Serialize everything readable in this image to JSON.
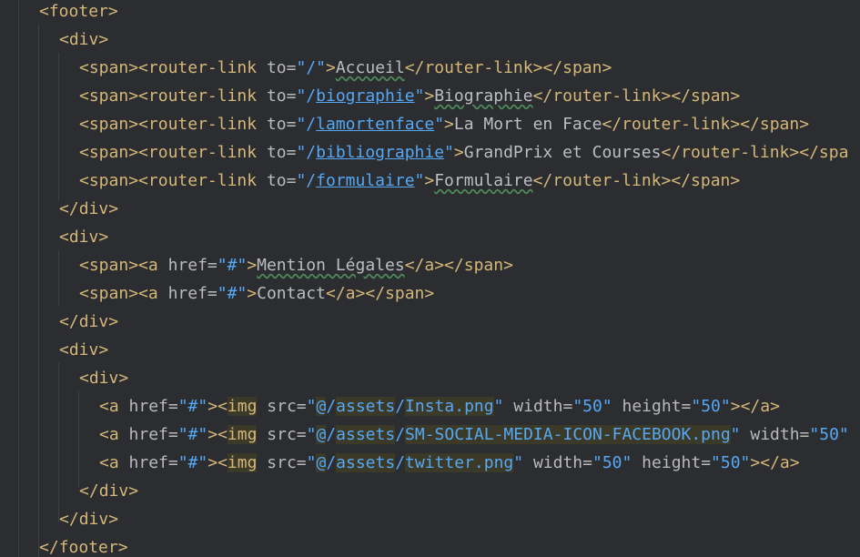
{
  "editor": {
    "lines": [
      {
        "indent": 1,
        "tokens": [
          {
            "t": "<",
            "c": "tk-bracket"
          },
          {
            "t": "footer",
            "c": "tk-tag"
          },
          {
            "t": ">",
            "c": "tk-bracket"
          }
        ]
      },
      {
        "indent": 2,
        "tokens": [
          {
            "t": "<",
            "c": "tk-bracket"
          },
          {
            "t": "div",
            "c": "tk-tag"
          },
          {
            "t": ">",
            "c": "tk-bracket"
          }
        ]
      },
      {
        "indent": 3,
        "tokens": [
          {
            "t": "<",
            "c": "tk-bracket"
          },
          {
            "t": "span",
            "c": "tk-tag"
          },
          {
            "t": "><",
            "c": "tk-bracket"
          },
          {
            "t": "router-link",
            "c": "tk-tag"
          },
          {
            "t": " to",
            "c": "tk-attr"
          },
          {
            "t": "=",
            "c": "tk-eq"
          },
          {
            "t": "\"",
            "c": "tk-strval"
          },
          {
            "t": "/",
            "c": "tk-strval"
          },
          {
            "t": "\"",
            "c": "tk-strval"
          },
          {
            "t": ">",
            "c": "tk-bracket"
          },
          {
            "t": "Accueil",
            "c": "tk-text tk-typo"
          },
          {
            "t": "</",
            "c": "tk-bracket"
          },
          {
            "t": "router-link",
            "c": "tk-tag"
          },
          {
            "t": "></",
            "c": "tk-bracket"
          },
          {
            "t": "span",
            "c": "tk-tag"
          },
          {
            "t": ">",
            "c": "tk-bracket"
          }
        ]
      },
      {
        "indent": 3,
        "tokens": [
          {
            "t": "<",
            "c": "tk-bracket"
          },
          {
            "t": "span",
            "c": "tk-tag"
          },
          {
            "t": "><",
            "c": "tk-bracket"
          },
          {
            "t": "router-link",
            "c": "tk-tag"
          },
          {
            "t": " to",
            "c": "tk-attr"
          },
          {
            "t": "=",
            "c": "tk-eq"
          },
          {
            "t": "\"/",
            "c": "tk-strval"
          },
          {
            "t": "biographie",
            "c": "tk-strval tk-link"
          },
          {
            "t": "\"",
            "c": "tk-strval"
          },
          {
            "t": ">",
            "c": "tk-bracket"
          },
          {
            "t": "Biographie",
            "c": "tk-text tk-typo"
          },
          {
            "t": "</",
            "c": "tk-bracket"
          },
          {
            "t": "router-link",
            "c": "tk-tag"
          },
          {
            "t": "></",
            "c": "tk-bracket"
          },
          {
            "t": "span",
            "c": "tk-tag"
          },
          {
            "t": ">",
            "c": "tk-bracket"
          }
        ]
      },
      {
        "indent": 3,
        "tokens": [
          {
            "t": "<",
            "c": "tk-bracket"
          },
          {
            "t": "span",
            "c": "tk-tag"
          },
          {
            "t": "><",
            "c": "tk-bracket"
          },
          {
            "t": "router-link",
            "c": "tk-tag"
          },
          {
            "t": " to",
            "c": "tk-attr"
          },
          {
            "t": "=",
            "c": "tk-eq"
          },
          {
            "t": "\"/",
            "c": "tk-strval"
          },
          {
            "t": "lamortenface",
            "c": "tk-strval tk-link"
          },
          {
            "t": "\"",
            "c": "tk-strval"
          },
          {
            "t": ">",
            "c": "tk-bracket"
          },
          {
            "t": "La Mort en Face",
            "c": "tk-text"
          },
          {
            "t": "</",
            "c": "tk-bracket"
          },
          {
            "t": "router-link",
            "c": "tk-tag"
          },
          {
            "t": "></",
            "c": "tk-bracket"
          },
          {
            "t": "span",
            "c": "tk-tag"
          },
          {
            "t": ">",
            "c": "tk-bracket"
          }
        ]
      },
      {
        "indent": 3,
        "tokens": [
          {
            "t": "<",
            "c": "tk-bracket"
          },
          {
            "t": "span",
            "c": "tk-tag"
          },
          {
            "t": "><",
            "c": "tk-bracket"
          },
          {
            "t": "router-link",
            "c": "tk-tag"
          },
          {
            "t": " to",
            "c": "tk-attr"
          },
          {
            "t": "=",
            "c": "tk-eq"
          },
          {
            "t": "\"/",
            "c": "tk-strval"
          },
          {
            "t": "bibliographie",
            "c": "tk-strval tk-link"
          },
          {
            "t": "\"",
            "c": "tk-strval"
          },
          {
            "t": ">",
            "c": "tk-bracket"
          },
          {
            "t": "GrandPrix et Courses",
            "c": "tk-text"
          },
          {
            "t": "</",
            "c": "tk-bracket"
          },
          {
            "t": "router-link",
            "c": "tk-tag"
          },
          {
            "t": "></",
            "c": "tk-bracket"
          },
          {
            "t": "spa",
            "c": "tk-tag"
          }
        ]
      },
      {
        "indent": 3,
        "tokens": [
          {
            "t": "<",
            "c": "tk-bracket"
          },
          {
            "t": "span",
            "c": "tk-tag"
          },
          {
            "t": "><",
            "c": "tk-bracket"
          },
          {
            "t": "router-link",
            "c": "tk-tag"
          },
          {
            "t": " to",
            "c": "tk-attr"
          },
          {
            "t": "=",
            "c": "tk-eq"
          },
          {
            "t": "\"/",
            "c": "tk-strval"
          },
          {
            "t": "formulaire",
            "c": "tk-strval tk-link"
          },
          {
            "t": "\"",
            "c": "tk-strval"
          },
          {
            "t": ">",
            "c": "tk-bracket"
          },
          {
            "t": "Formulaire",
            "c": "tk-text tk-typo"
          },
          {
            "t": "</",
            "c": "tk-bracket"
          },
          {
            "t": "router-link",
            "c": "tk-tag"
          },
          {
            "t": "></",
            "c": "tk-bracket"
          },
          {
            "t": "span",
            "c": "tk-tag"
          },
          {
            "t": ">",
            "c": "tk-bracket"
          }
        ]
      },
      {
        "indent": 2,
        "tokens": [
          {
            "t": "</",
            "c": "tk-bracket"
          },
          {
            "t": "div",
            "c": "tk-tag"
          },
          {
            "t": ">",
            "c": "tk-bracket"
          }
        ]
      },
      {
        "indent": 2,
        "tokens": [
          {
            "t": "<",
            "c": "tk-bracket"
          },
          {
            "t": "div",
            "c": "tk-tag"
          },
          {
            "t": ">",
            "c": "tk-bracket"
          }
        ]
      },
      {
        "indent": 3,
        "tokens": [
          {
            "t": "<",
            "c": "tk-bracket"
          },
          {
            "t": "span",
            "c": "tk-tag"
          },
          {
            "t": "><",
            "c": "tk-bracket"
          },
          {
            "t": "a",
            "c": "tk-tag"
          },
          {
            "t": " href",
            "c": "tk-attr"
          },
          {
            "t": "=",
            "c": "tk-eq"
          },
          {
            "t": "\"#\"",
            "c": "tk-strval"
          },
          {
            "t": ">",
            "c": "tk-bracket"
          },
          {
            "t": "Mention Légales",
            "c": "tk-text tk-typo"
          },
          {
            "t": "</",
            "c": "tk-bracket"
          },
          {
            "t": "a",
            "c": "tk-tag"
          },
          {
            "t": "></",
            "c": "tk-bracket"
          },
          {
            "t": "span",
            "c": "tk-tag"
          },
          {
            "t": ">",
            "c": "tk-bracket"
          }
        ]
      },
      {
        "indent": 3,
        "tokens": [
          {
            "t": "<",
            "c": "tk-bracket"
          },
          {
            "t": "span",
            "c": "tk-tag"
          },
          {
            "t": "><",
            "c": "tk-bracket"
          },
          {
            "t": "a",
            "c": "tk-tag"
          },
          {
            "t": " href",
            "c": "tk-attr"
          },
          {
            "t": "=",
            "c": "tk-eq"
          },
          {
            "t": "\"#\"",
            "c": "tk-strval"
          },
          {
            "t": ">",
            "c": "tk-bracket"
          },
          {
            "t": "Contact",
            "c": "tk-text"
          },
          {
            "t": "</",
            "c": "tk-bracket"
          },
          {
            "t": "a",
            "c": "tk-tag"
          },
          {
            "t": "></",
            "c": "tk-bracket"
          },
          {
            "t": "span",
            "c": "tk-tag"
          },
          {
            "t": ">",
            "c": "tk-bracket"
          }
        ]
      },
      {
        "indent": 2,
        "tokens": [
          {
            "t": "</",
            "c": "tk-bracket"
          },
          {
            "t": "div",
            "c": "tk-tag"
          },
          {
            "t": ">",
            "c": "tk-bracket"
          }
        ]
      },
      {
        "indent": 2,
        "tokens": [
          {
            "t": "<",
            "c": "tk-bracket"
          },
          {
            "t": "div",
            "c": "tk-tag"
          },
          {
            "t": ">",
            "c": "tk-bracket"
          }
        ]
      },
      {
        "indent": 3,
        "tokens": [
          {
            "t": "<",
            "c": "tk-bracket"
          },
          {
            "t": "div",
            "c": "tk-tag"
          },
          {
            "t": ">",
            "c": "tk-bracket"
          }
        ]
      },
      {
        "indent": 4,
        "tokens": [
          {
            "t": "<",
            "c": "tk-bracket"
          },
          {
            "t": "a",
            "c": "tk-tag"
          },
          {
            "t": " href",
            "c": "tk-attr"
          },
          {
            "t": "=",
            "c": "tk-eq"
          },
          {
            "t": "\"#\"",
            "c": "tk-strval"
          },
          {
            "t": "><",
            "c": "tk-bracket"
          },
          {
            "t": "img",
            "c": "tk-tag hl"
          },
          {
            "t": " src",
            "c": "tk-attr"
          },
          {
            "t": "=",
            "c": "tk-eq"
          },
          {
            "t": "\"",
            "c": "tk-strval"
          },
          {
            "t": "@",
            "c": "tk-strval hl"
          },
          {
            "t": "/",
            "c": "tk-strval"
          },
          {
            "t": "assets",
            "c": "tk-strval hl"
          },
          {
            "t": "/",
            "c": "tk-strval"
          },
          {
            "t": "Insta.png",
            "c": "tk-strval hl"
          },
          {
            "t": "\"",
            "c": "tk-strval"
          },
          {
            "t": " width",
            "c": "tk-attr"
          },
          {
            "t": "=",
            "c": "tk-eq"
          },
          {
            "t": "\"50\"",
            "c": "tk-strval"
          },
          {
            "t": " height",
            "c": "tk-attr"
          },
          {
            "t": "=",
            "c": "tk-eq"
          },
          {
            "t": "\"50\"",
            "c": "tk-strval"
          },
          {
            "t": "></",
            "c": "tk-bracket"
          },
          {
            "t": "a",
            "c": "tk-tag"
          },
          {
            "t": ">",
            "c": "tk-bracket"
          }
        ]
      },
      {
        "indent": 4,
        "tokens": [
          {
            "t": "<",
            "c": "tk-bracket"
          },
          {
            "t": "a",
            "c": "tk-tag"
          },
          {
            "t": " href",
            "c": "tk-attr"
          },
          {
            "t": "=",
            "c": "tk-eq"
          },
          {
            "t": "\"#\"",
            "c": "tk-strval"
          },
          {
            "t": "><",
            "c": "tk-bracket"
          },
          {
            "t": "img",
            "c": "tk-tag hl"
          },
          {
            "t": " src",
            "c": "tk-attr"
          },
          {
            "t": "=",
            "c": "tk-eq"
          },
          {
            "t": "\"",
            "c": "tk-strval"
          },
          {
            "t": "@",
            "c": "tk-strval hl"
          },
          {
            "t": "/",
            "c": "tk-strval"
          },
          {
            "t": "assets",
            "c": "tk-strval hl"
          },
          {
            "t": "/",
            "c": "tk-strval"
          },
          {
            "t": "SM-SOCIAL-MEDIA-ICON-FACEBOOK.png",
            "c": "tk-strval hl"
          },
          {
            "t": "\"",
            "c": "tk-strval"
          },
          {
            "t": " width",
            "c": "tk-attr"
          },
          {
            "t": "=",
            "c": "tk-eq"
          },
          {
            "t": "\"50\"",
            "c": "tk-strval"
          }
        ]
      },
      {
        "indent": 4,
        "tokens": [
          {
            "t": "<",
            "c": "tk-bracket"
          },
          {
            "t": "a",
            "c": "tk-tag"
          },
          {
            "t": " href",
            "c": "tk-attr"
          },
          {
            "t": "=",
            "c": "tk-eq"
          },
          {
            "t": "\"#\"",
            "c": "tk-strval"
          },
          {
            "t": "><",
            "c": "tk-bracket"
          },
          {
            "t": "img",
            "c": "tk-tag hl"
          },
          {
            "t": " src",
            "c": "tk-attr"
          },
          {
            "t": "=",
            "c": "tk-eq"
          },
          {
            "t": "\"",
            "c": "tk-strval"
          },
          {
            "t": "@",
            "c": "tk-strval hl"
          },
          {
            "t": "/",
            "c": "tk-strval"
          },
          {
            "t": "assets",
            "c": "tk-strval hl"
          },
          {
            "t": "/",
            "c": "tk-strval"
          },
          {
            "t": "twitter.png",
            "c": "tk-strval hl"
          },
          {
            "t": "\"",
            "c": "tk-strval"
          },
          {
            "t": " width",
            "c": "tk-attr"
          },
          {
            "t": "=",
            "c": "tk-eq"
          },
          {
            "t": "\"50\"",
            "c": "tk-strval"
          },
          {
            "t": " height",
            "c": "tk-attr"
          },
          {
            "t": "=",
            "c": "tk-eq"
          },
          {
            "t": "\"50\"",
            "c": "tk-strval"
          },
          {
            "t": "></",
            "c": "tk-bracket"
          },
          {
            "t": "a",
            "c": "tk-tag"
          },
          {
            "t": ">",
            "c": "tk-bracket"
          }
        ]
      },
      {
        "indent": 3,
        "tokens": [
          {
            "t": "</",
            "c": "tk-bracket"
          },
          {
            "t": "div",
            "c": "tk-tag"
          },
          {
            "t": ">",
            "c": "tk-bracket"
          }
        ]
      },
      {
        "indent": 2,
        "tokens": [
          {
            "t": "</",
            "c": "tk-bracket"
          },
          {
            "t": "div",
            "c": "tk-tag"
          },
          {
            "t": ">",
            "c": "tk-bracket"
          }
        ]
      },
      {
        "indent": 1,
        "tokens": [
          {
            "t": "</",
            "c": "tk-bracket"
          },
          {
            "t": "footer",
            "c": "tk-tag"
          },
          {
            "t": ">",
            "c": "tk-bracket"
          }
        ]
      }
    ]
  }
}
